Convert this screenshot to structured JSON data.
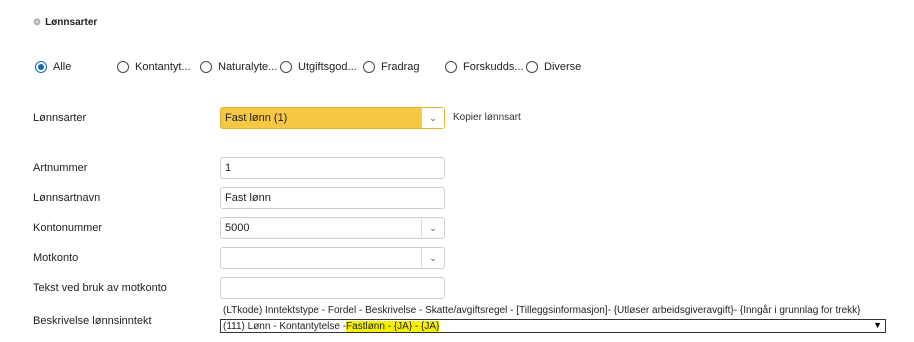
{
  "section": {
    "icon": "cog-icon",
    "title": "Lønnsarter"
  },
  "radios": [
    {
      "label": "Alle",
      "checked": true
    },
    {
      "label": "Kontantyt...",
      "checked": false
    },
    {
      "label": "Naturalyte...",
      "checked": false
    },
    {
      "label": "Utgiftsgod...",
      "checked": false
    },
    {
      "label": "Fradrag",
      "checked": false
    },
    {
      "label": "Forskudds...",
      "checked": false
    },
    {
      "label": "Diverse",
      "checked": false
    }
  ],
  "lonnsarter": {
    "label": "Lønnsarter",
    "value": "Fast lønn (1)",
    "copy_label": "Kopier lønnsart"
  },
  "fields": {
    "artnummer": {
      "label": "Artnummer",
      "value": "1"
    },
    "navn": {
      "label": "Lønnsartnavn",
      "value": "Fast lønn"
    },
    "kontonummer": {
      "label": "Kontonummer",
      "value": "5000"
    },
    "motkonto": {
      "label": "Motkonto",
      "value": ""
    },
    "tekst": {
      "label": "Tekst ved bruk av motkonto",
      "value": ""
    },
    "beskrivelse": {
      "label": "Beskrivelse lønnsinntekt",
      "header": "(LTkode) Inntektstype - Fordel - Beskrivelse - Skatte/avgiftsregel - [Tilleggsinformasjon]- {Utløser arbeidsgiveravgift}- {Inngår i grunnlag for trekk}",
      "value_prefix": "(111) Lønn - Kontantytelse - ",
      "value_highlight": "Fastlønn - {JA} - {JA}"
    }
  },
  "colors": {
    "accent": "#1565c0",
    "dropdown_highlight": "#f6c744",
    "text_highlight": "#f5f000"
  }
}
